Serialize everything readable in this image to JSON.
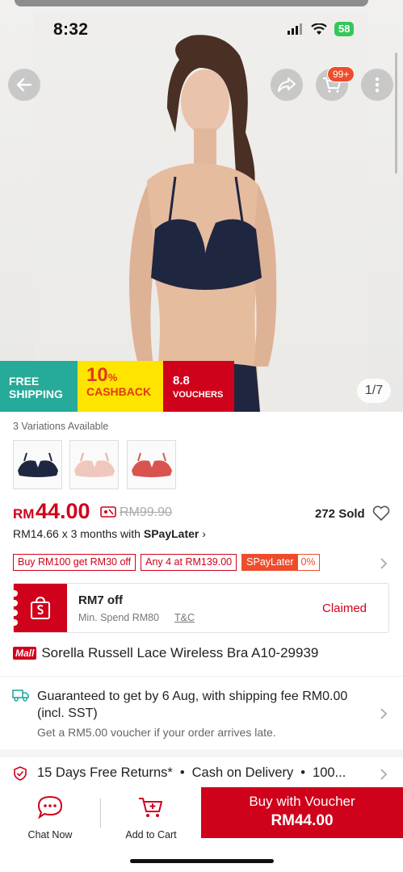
{
  "status_bar": {
    "time": "8:32",
    "battery": "58"
  },
  "header": {
    "cart_badge": "99+"
  },
  "image_counter": "1/7",
  "promo": {
    "free_shipping_line1": "FREE",
    "free_shipping_line2": "SHIPPING",
    "cashback_value": "10",
    "cashback_pct": "%",
    "cashback_label": "CASHBACK",
    "vouchers_date": "8.8",
    "vouchers_label": "VOUCHERS"
  },
  "variations": {
    "label": "3 Variations Available",
    "swatches": [
      {
        "name": "navy",
        "color": "#1f2640"
      },
      {
        "name": "nude",
        "color": "#f0c7bd"
      },
      {
        "name": "coral",
        "color": "#d9544e"
      }
    ]
  },
  "price": {
    "currency": "RM",
    "amount": "44.00",
    "original": "RM99.90",
    "sold": "272 Sold",
    "installment_text": "RM14.66 x 3 months with ",
    "installment_brand": "SPayLater",
    "installment_chevron": "›"
  },
  "tags": {
    "tag1": "Buy RM100 get RM30 off",
    "tag2": "Any 4 at RM139.00",
    "spaylater_label": "SPayLater",
    "spaylater_rate": "0%"
  },
  "voucher": {
    "title": "RM7 off",
    "min_spend": "Min. Spend RM80",
    "tc": "T&C",
    "status": "Claimed"
  },
  "product": {
    "mall_badge": "Mall",
    "title": "Sorella Russell Lace Wireless Bra A10-29939"
  },
  "shipping": {
    "main": "Guaranteed to get by 6 Aug, with shipping fee RM0.00 (incl. SST)",
    "sub": "Get a RM5.00 voucher if your order arrives late."
  },
  "services": {
    "returns": "15 Days Free Returns*",
    "cod": "Cash on Delivery",
    "more": "100...",
    "separator": "•"
  },
  "bottom_bar": {
    "chat_label": "Chat Now",
    "cart_label": "Add to Cart",
    "buy_line1": "Buy with Voucher",
    "buy_line2": "RM44.00"
  },
  "colors": {
    "brand_red": "#d0011b",
    "shopee_orange": "#ee4d2d",
    "teal": "#26aa99",
    "yellow": "#ffe400"
  }
}
